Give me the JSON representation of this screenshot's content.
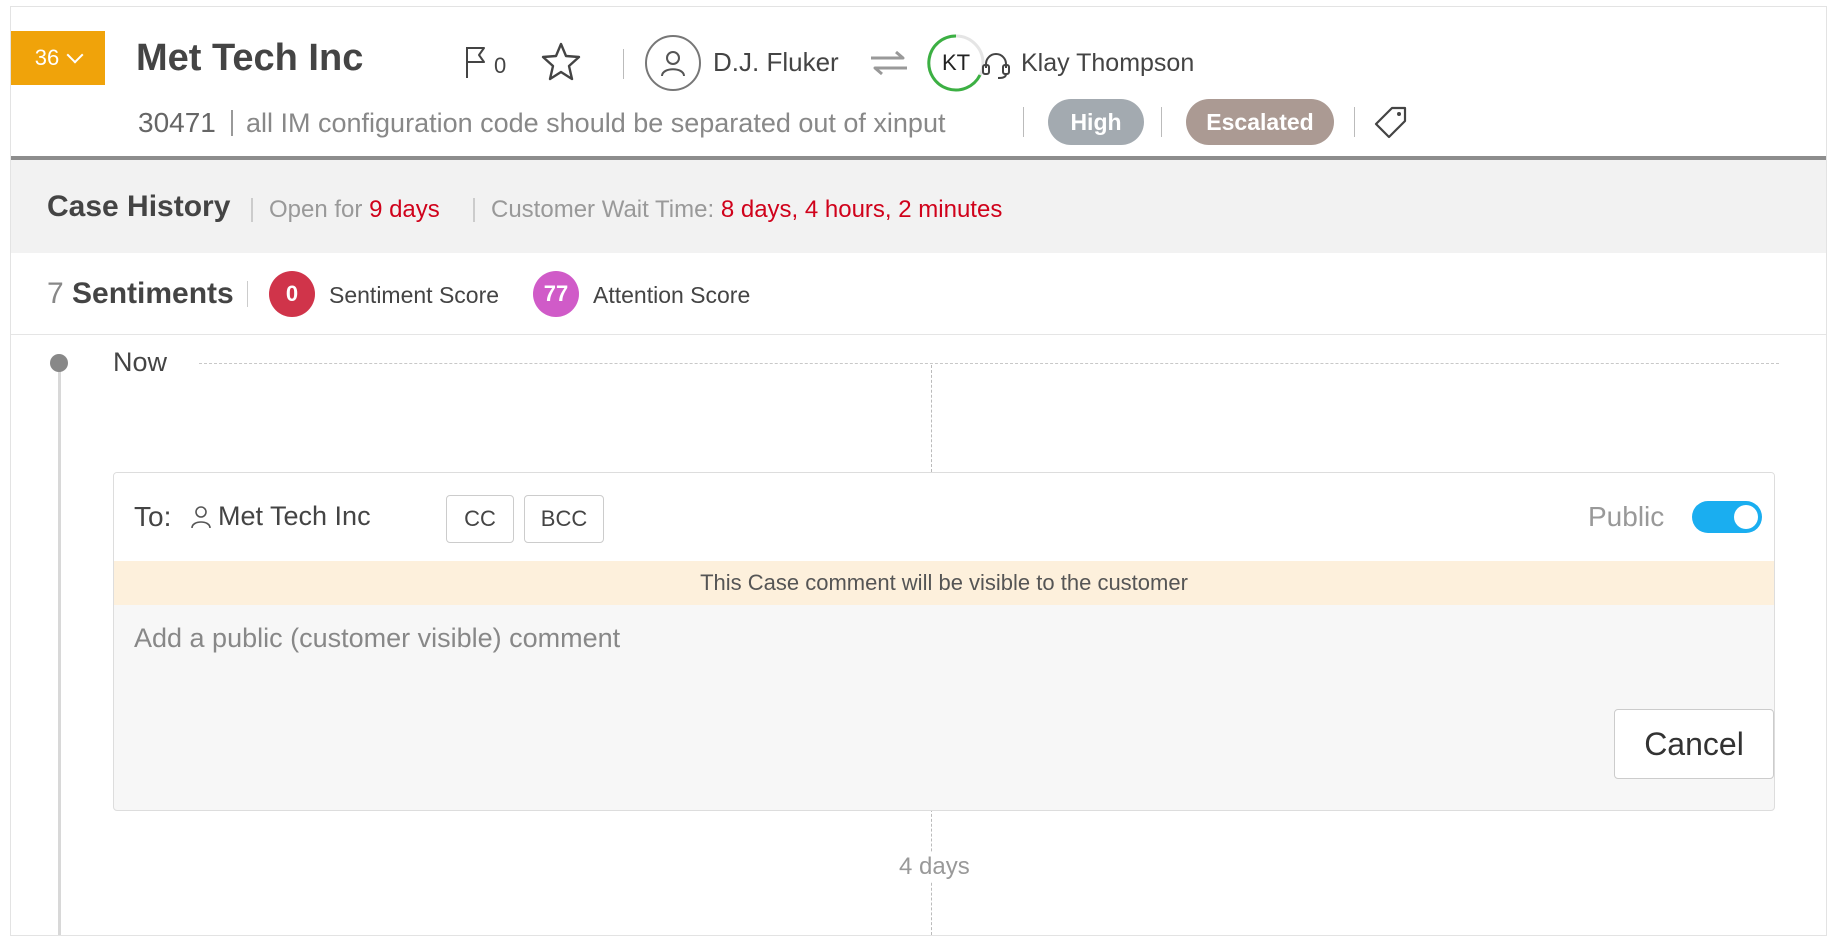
{
  "header": {
    "count_badge": "36",
    "account_name": "Met Tech Inc",
    "flag_count": "0",
    "owner_name": "D.J. Fluker",
    "agent_initials": "KT",
    "agent_name": "Klay Thompson",
    "case_number": "30471",
    "case_subject": "all IM configuration code should be separated out of xinput",
    "priority": "High",
    "status": "Escalated",
    "colors": {
      "badge": "#f0a30a",
      "priority": "#a3aab0",
      "status": "#ab9a93",
      "agent_ring": "#3cb043"
    }
  },
  "case_history": {
    "title": "Case History",
    "open_for_label": "Open for",
    "open_for_value": "9 days",
    "wait_label": "Customer Wait Time:",
    "wait_value": "8 days, 4 hours, 2 minutes"
  },
  "sentiments": {
    "count": "7",
    "label": "Sentiments",
    "sentiment_score": "0",
    "sentiment_score_label": "Sentiment Score",
    "attention_score": "77",
    "attention_score_label": "Attention Score"
  },
  "timeline": {
    "now_label": "Now",
    "gap_label": "4 days"
  },
  "comment_box": {
    "to_label": "To:",
    "recipient": "Met Tech Inc",
    "cc_label": "CC",
    "bcc_label": "BCC",
    "public_label": "Public",
    "public_on": true,
    "notice": "This Case comment will be visible to the customer",
    "placeholder": "Add a public (customer visible) comment",
    "cancel_label": "Cancel"
  },
  "icons": [
    "chevron-down-icon",
    "flag-icon",
    "star-icon",
    "user-icon",
    "swap-icon",
    "headset-icon",
    "tag-icon",
    "person-icon"
  ]
}
